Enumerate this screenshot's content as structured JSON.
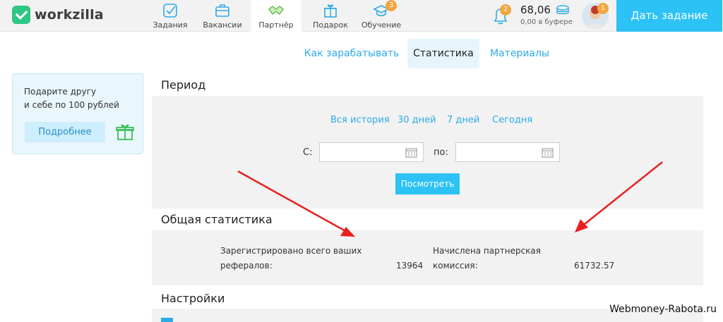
{
  "app": {
    "brand": "workzilla"
  },
  "nav": [
    {
      "label": "Задания",
      "icon": "tasks-icon",
      "badge": ""
    },
    {
      "label": "Вакансии",
      "icon": "briefcase-icon",
      "badge": ""
    },
    {
      "label": "Партнёр",
      "icon": "handshake-icon",
      "badge": ""
    },
    {
      "label": "Подарок",
      "icon": "gift-icon",
      "badge": ""
    },
    {
      "label": "Обучение",
      "icon": "graduation-cap-icon",
      "badge": "3"
    }
  ],
  "notifications": {
    "badge": "2",
    "icon": "bell-icon"
  },
  "balance": {
    "amount": "68,06",
    "buffer": "0,00 в буфере",
    "icon": "coins-icon"
  },
  "profile": {
    "badge": "1"
  },
  "cta": {
    "label": "Дать задание"
  },
  "subtabs": [
    {
      "label": "Как зарабатывать"
    },
    {
      "label": "Статистика"
    },
    {
      "label": "Материалы"
    }
  ],
  "promo": {
    "line1": "Подарите другу",
    "line2": "и себе по 100 рублей",
    "button": "Подробнее"
  },
  "period": {
    "heading": "Период",
    "links": [
      "Вся история",
      "30 дней",
      "7 дней",
      "Сегодня"
    ],
    "from_label": "С:",
    "to_label": "по:",
    "from_value": "",
    "to_value": "",
    "submit": "Посмотреть"
  },
  "stats": {
    "heading": "Общая статистика",
    "referrals_label_1": "Зарегистрировано всего ваших",
    "referrals_label_2": "рефералов:",
    "referrals_value": "13964",
    "commission_label_1": "Начислена партнерская",
    "commission_label_2": "комиссия:",
    "commission_value": "61732.57"
  },
  "settings": {
    "heading": "Настройки"
  },
  "watermark": "Webmoney-Rabota.ru",
  "colors": {
    "accent": "#2cc2f5",
    "link": "#2cabe6",
    "brand_green": "#2fc784",
    "badge": "#f2a640",
    "arrow": "#e8201f"
  }
}
